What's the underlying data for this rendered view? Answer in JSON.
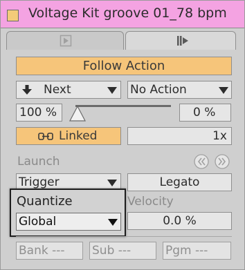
{
  "title": "Voltage Kit groove 01_78 bpm",
  "tabs": [
    "clip-tab-icon",
    "launch-tab-icon"
  ],
  "follow_action": {
    "header": "Follow Action",
    "action_a": "Next",
    "action_b": "No Action",
    "chance_a": "100 %",
    "chance_b": "0 %",
    "linked": "Linked",
    "multiplier": "1x"
  },
  "launch": {
    "label": "Launch",
    "mode": "Trigger",
    "legato": "Legato",
    "quantize_label": "Quantize",
    "quantize_value": "Global",
    "velocity_label": "Velocity",
    "velocity_value": "0.0 %"
  },
  "program_change": {
    "bank": "Bank ---",
    "sub": "Sub ---",
    "pgm": "Pgm ---"
  },
  "colors": {
    "title_bar": "#f4a3e2",
    "accent_orange": "#f6c57a",
    "panel_bg": "#cfcfcf"
  }
}
